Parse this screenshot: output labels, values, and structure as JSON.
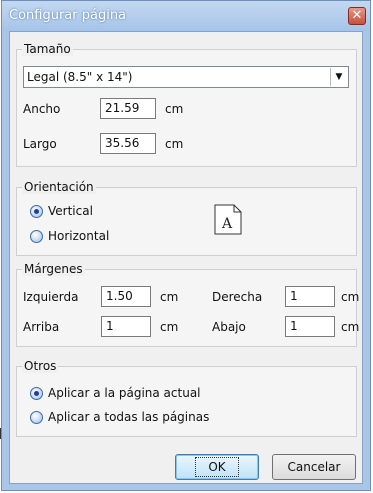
{
  "window": {
    "title": "Configurar página"
  },
  "size": {
    "legend": "Tamaño",
    "paper_selected": "Legal (8.5\" x 14\")",
    "width_label": "Ancho",
    "width_value": "21.59",
    "width_unit": "cm",
    "height_label": "Largo",
    "height_value": "35.56",
    "height_unit": "cm"
  },
  "orientation": {
    "legend": "Orientación",
    "options": [
      {
        "label": "Vertical",
        "selected": true
      },
      {
        "label": "Horizontal",
        "selected": false
      }
    ],
    "preview_letter": "A"
  },
  "margins": {
    "legend": "Márgenes",
    "left_label": "Izquierda",
    "left_value": "1.50",
    "right_label": "Derecha",
    "right_value": "1",
    "top_label": "Arriba",
    "top_value": "1",
    "bottom_label": "Abajo",
    "bottom_value": "1",
    "unit": "cm"
  },
  "other": {
    "legend": "Otros",
    "options": [
      {
        "label": "Aplicar a la página actual",
        "selected": true
      },
      {
        "label": "Aplicar a todas las páginas",
        "selected": false
      }
    ]
  },
  "buttons": {
    "ok": "OK",
    "cancel": "Cancelar"
  }
}
